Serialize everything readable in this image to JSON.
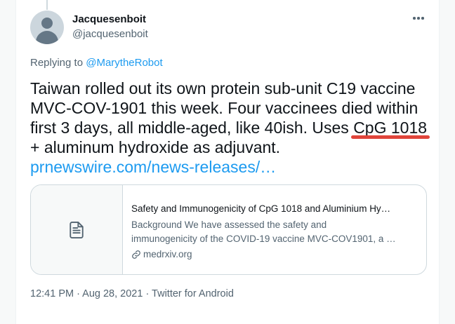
{
  "tweet": {
    "display_name": "Jacquesenboit",
    "handle": "@jacquesenboit",
    "replying_prefix": "Replying to ",
    "replying_to": "@MarytheRobot",
    "text_line1": "Taiwan rolled out its own protein sub-unit C19 vaccine",
    "text_line2": "MVC-COV-1901 this week. Four vaccinees died within",
    "text_line3": "first 3 days, all middle-aged, like 40ish. Uses CpG 1018",
    "text_line4": "+ aluminum hydroxide as adjuvant.",
    "link": "prnewswire.com/news-releases/…",
    "timestamp": "12:41 PM · Aug 28, 2021 · Twitter for Android"
  },
  "card": {
    "title": "Safety and Immunogenicity of CpG 1018 and Aluminium Hy…",
    "desc_line1": "Background We have assessed the safety and",
    "desc_line2": "immunogenicity of the COVID-19 vaccine MVC-COV1901, a …",
    "source": "medrxiv.org",
    "thumb_icon": "document-icon",
    "source_icon": "link-icon"
  },
  "colors": {
    "link": "#1d9bf0",
    "text": "#0f1419",
    "secondary": "#536471",
    "annotation": "#e0443a"
  }
}
